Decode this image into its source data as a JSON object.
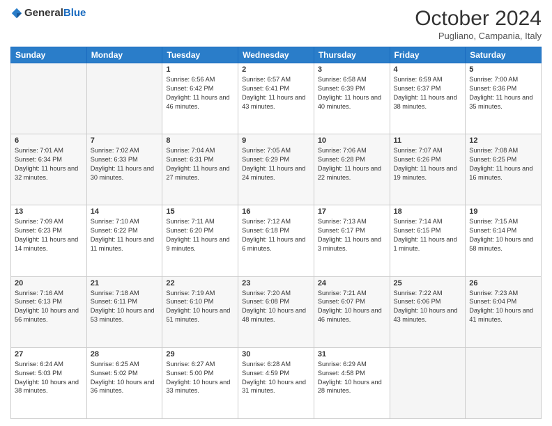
{
  "header": {
    "logo": {
      "general": "General",
      "blue": "Blue"
    },
    "title": "October 2024",
    "location": "Pugliano, Campania, Italy"
  },
  "weekdays": [
    "Sunday",
    "Monday",
    "Tuesday",
    "Wednesday",
    "Thursday",
    "Friday",
    "Saturday"
  ],
  "weeks": [
    [
      {
        "day": "",
        "empty": true
      },
      {
        "day": "",
        "empty": true
      },
      {
        "day": "1",
        "sunrise": "Sunrise: 6:56 AM",
        "sunset": "Sunset: 6:42 PM",
        "daylight": "Daylight: 11 hours and 46 minutes."
      },
      {
        "day": "2",
        "sunrise": "Sunrise: 6:57 AM",
        "sunset": "Sunset: 6:41 PM",
        "daylight": "Daylight: 11 hours and 43 minutes."
      },
      {
        "day": "3",
        "sunrise": "Sunrise: 6:58 AM",
        "sunset": "Sunset: 6:39 PM",
        "daylight": "Daylight: 11 hours and 40 minutes."
      },
      {
        "day": "4",
        "sunrise": "Sunrise: 6:59 AM",
        "sunset": "Sunset: 6:37 PM",
        "daylight": "Daylight: 11 hours and 38 minutes."
      },
      {
        "day": "5",
        "sunrise": "Sunrise: 7:00 AM",
        "sunset": "Sunset: 6:36 PM",
        "daylight": "Daylight: 11 hours and 35 minutes."
      }
    ],
    [
      {
        "day": "6",
        "sunrise": "Sunrise: 7:01 AM",
        "sunset": "Sunset: 6:34 PM",
        "daylight": "Daylight: 11 hours and 32 minutes."
      },
      {
        "day": "7",
        "sunrise": "Sunrise: 7:02 AM",
        "sunset": "Sunset: 6:33 PM",
        "daylight": "Daylight: 11 hours and 30 minutes."
      },
      {
        "day": "8",
        "sunrise": "Sunrise: 7:04 AM",
        "sunset": "Sunset: 6:31 PM",
        "daylight": "Daylight: 11 hours and 27 minutes."
      },
      {
        "day": "9",
        "sunrise": "Sunrise: 7:05 AM",
        "sunset": "Sunset: 6:29 PM",
        "daylight": "Daylight: 11 hours and 24 minutes."
      },
      {
        "day": "10",
        "sunrise": "Sunrise: 7:06 AM",
        "sunset": "Sunset: 6:28 PM",
        "daylight": "Daylight: 11 hours and 22 minutes."
      },
      {
        "day": "11",
        "sunrise": "Sunrise: 7:07 AM",
        "sunset": "Sunset: 6:26 PM",
        "daylight": "Daylight: 11 hours and 19 minutes."
      },
      {
        "day": "12",
        "sunrise": "Sunrise: 7:08 AM",
        "sunset": "Sunset: 6:25 PM",
        "daylight": "Daylight: 11 hours and 16 minutes."
      }
    ],
    [
      {
        "day": "13",
        "sunrise": "Sunrise: 7:09 AM",
        "sunset": "Sunset: 6:23 PM",
        "daylight": "Daylight: 11 hours and 14 minutes."
      },
      {
        "day": "14",
        "sunrise": "Sunrise: 7:10 AM",
        "sunset": "Sunset: 6:22 PM",
        "daylight": "Daylight: 11 hours and 11 minutes."
      },
      {
        "day": "15",
        "sunrise": "Sunrise: 7:11 AM",
        "sunset": "Sunset: 6:20 PM",
        "daylight": "Daylight: 11 hours and 9 minutes."
      },
      {
        "day": "16",
        "sunrise": "Sunrise: 7:12 AM",
        "sunset": "Sunset: 6:18 PM",
        "daylight": "Daylight: 11 hours and 6 minutes."
      },
      {
        "day": "17",
        "sunrise": "Sunrise: 7:13 AM",
        "sunset": "Sunset: 6:17 PM",
        "daylight": "Daylight: 11 hours and 3 minutes."
      },
      {
        "day": "18",
        "sunrise": "Sunrise: 7:14 AM",
        "sunset": "Sunset: 6:15 PM",
        "daylight": "Daylight: 11 hours and 1 minute."
      },
      {
        "day": "19",
        "sunrise": "Sunrise: 7:15 AM",
        "sunset": "Sunset: 6:14 PM",
        "daylight": "Daylight: 10 hours and 58 minutes."
      }
    ],
    [
      {
        "day": "20",
        "sunrise": "Sunrise: 7:16 AM",
        "sunset": "Sunset: 6:13 PM",
        "daylight": "Daylight: 10 hours and 56 minutes."
      },
      {
        "day": "21",
        "sunrise": "Sunrise: 7:18 AM",
        "sunset": "Sunset: 6:11 PM",
        "daylight": "Daylight: 10 hours and 53 minutes."
      },
      {
        "day": "22",
        "sunrise": "Sunrise: 7:19 AM",
        "sunset": "Sunset: 6:10 PM",
        "daylight": "Daylight: 10 hours and 51 minutes."
      },
      {
        "day": "23",
        "sunrise": "Sunrise: 7:20 AM",
        "sunset": "Sunset: 6:08 PM",
        "daylight": "Daylight: 10 hours and 48 minutes."
      },
      {
        "day": "24",
        "sunrise": "Sunrise: 7:21 AM",
        "sunset": "Sunset: 6:07 PM",
        "daylight": "Daylight: 10 hours and 46 minutes."
      },
      {
        "day": "25",
        "sunrise": "Sunrise: 7:22 AM",
        "sunset": "Sunset: 6:06 PM",
        "daylight": "Daylight: 10 hours and 43 minutes."
      },
      {
        "day": "26",
        "sunrise": "Sunrise: 7:23 AM",
        "sunset": "Sunset: 6:04 PM",
        "daylight": "Daylight: 10 hours and 41 minutes."
      }
    ],
    [
      {
        "day": "27",
        "sunrise": "Sunrise: 6:24 AM",
        "sunset": "Sunset: 5:03 PM",
        "daylight": "Daylight: 10 hours and 38 minutes."
      },
      {
        "day": "28",
        "sunrise": "Sunrise: 6:25 AM",
        "sunset": "Sunset: 5:02 PM",
        "daylight": "Daylight: 10 hours and 36 minutes."
      },
      {
        "day": "29",
        "sunrise": "Sunrise: 6:27 AM",
        "sunset": "Sunset: 5:00 PM",
        "daylight": "Daylight: 10 hours and 33 minutes."
      },
      {
        "day": "30",
        "sunrise": "Sunrise: 6:28 AM",
        "sunset": "Sunset: 4:59 PM",
        "daylight": "Daylight: 10 hours and 31 minutes."
      },
      {
        "day": "31",
        "sunrise": "Sunrise: 6:29 AM",
        "sunset": "Sunset: 4:58 PM",
        "daylight": "Daylight: 10 hours and 28 minutes."
      },
      {
        "day": "",
        "empty": true
      },
      {
        "day": "",
        "empty": true
      }
    ]
  ]
}
